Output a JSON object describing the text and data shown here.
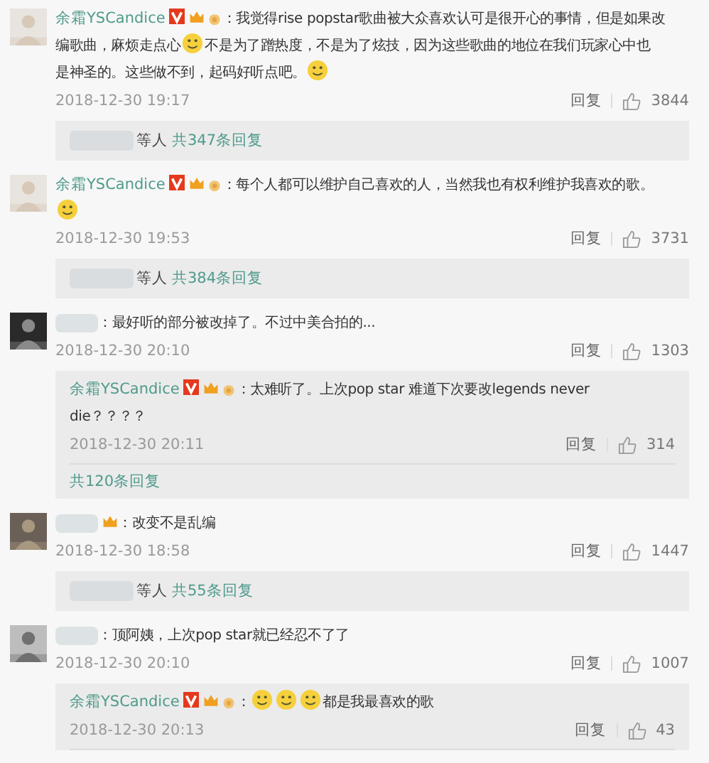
{
  "comments": [
    {
      "author": {
        "name": "余霜YSCandice",
        "verified": true,
        "vip": true,
        "medal": true
      },
      "content": [
        {
          "kind": "text",
          "text": "：我觉得rise popstar歌曲被大众喜欢认可是很开心的事情，但是如果改"
        },
        {
          "kind": "break"
        },
        {
          "kind": "text",
          "text": "编歌曲，麻烦走点心"
        },
        {
          "kind": "emoji"
        },
        {
          "kind": "text",
          "text": "不是为了蹭热度，不是为了炫技，因为这些歌曲的地位在我们玩家心中也"
        },
        {
          "kind": "break"
        },
        {
          "kind": "text",
          "text": "是神圣的。这些做不到，起码好听点吧。"
        },
        {
          "kind": "emoji"
        }
      ],
      "time": "2018-12-30 19:17",
      "reply": "回复",
      "likes": "3844",
      "thread": {
        "kind": "summary",
        "who": "等人",
        "link": "共347条回复"
      }
    },
    {
      "author": {
        "name": "余霜YSCandice",
        "verified": true,
        "vip": true,
        "medal": true
      },
      "content": [
        {
          "kind": "text",
          "text": "：每个人都可以维护自己喜欢的人，当然我也有权利维护我喜欢的歌。"
        },
        {
          "kind": "break"
        },
        {
          "kind": "emoji"
        }
      ],
      "time": "2018-12-30 19:53",
      "reply": "回复",
      "likes": "3731",
      "thread": {
        "kind": "summary",
        "who": "等人",
        "link": "共384条回复"
      }
    },
    {
      "author": {
        "verified": false,
        "vip": false,
        "medal": false
      },
      "content": [
        {
          "kind": "text",
          "text": "：最好听的部分被改掉了。不过中美合拍的..."
        }
      ],
      "time": "2018-12-30 20:10",
      "reply": "回复",
      "likes": "1303",
      "thread": {
        "kind": "replies",
        "link": "共120条回复",
        "replies": [
          {
            "author": {
              "name": "余霜YSCandice",
              "verified": true,
              "vip": true,
              "medal": true
            },
            "content": [
              {
                "kind": "text",
                "text": "：太难听了。上次pop star 难道下次要改legends never"
              },
              {
                "kind": "break"
              },
              {
                "kind": "text",
                "text": "die？？？？"
              }
            ],
            "time": "2018-12-30 20:11",
            "reply": "回复",
            "likes": "314"
          }
        ]
      }
    },
    {
      "author": {
        "verified": false,
        "vip": true,
        "medal": false
      },
      "content": [
        {
          "kind": "text",
          "text": "：改变不是乱编"
        }
      ],
      "time": "2018-12-30 18:58",
      "reply": "回复",
      "likes": "1447",
      "thread": {
        "kind": "summary",
        "who": "等人",
        "link": "共55条回复"
      }
    },
    {
      "author": {
        "verified": false,
        "vip": false,
        "medal": false
      },
      "content": [
        {
          "kind": "text",
          "text": "：顶阿姨，上次pop star就已经忍不了了"
        }
      ],
      "time": "2018-12-30 20:10",
      "reply": "回复",
      "likes": "1007",
      "thread": {
        "kind": "replies",
        "replies": [
          {
            "author": {
              "name": "余霜YSCandice",
              "verified": true,
              "vip": true,
              "medal": true
            },
            "content": [
              {
                "kind": "text",
                "text": "："
              },
              {
                "kind": "emoji"
              },
              {
                "kind": "emoji"
              },
              {
                "kind": "emoji"
              },
              {
                "kind": "text",
                "text": "都是我最喜欢的歌"
              }
            ],
            "time": "2018-12-30 20:13",
            "reply": "回复",
            "likes": "43"
          }
        ]
      }
    }
  ]
}
